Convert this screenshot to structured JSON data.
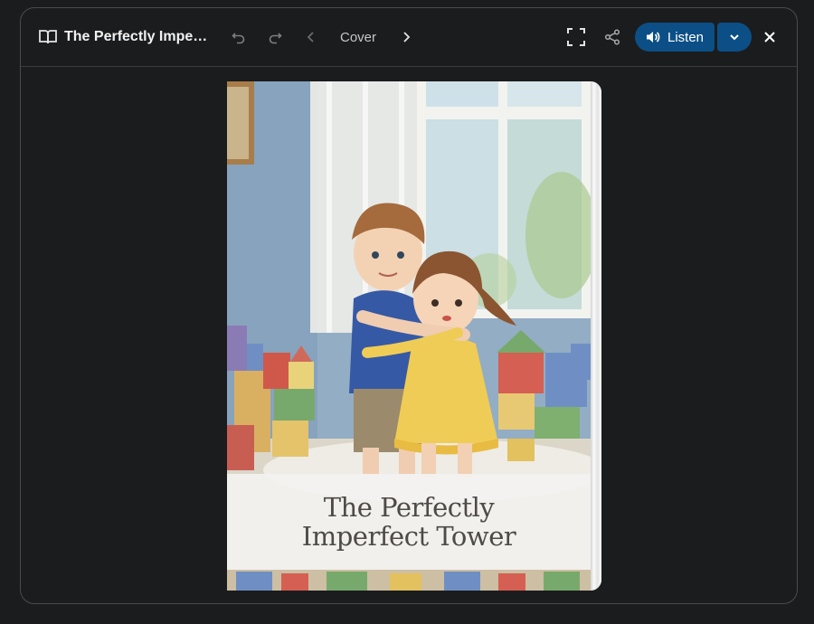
{
  "toolbar": {
    "book_icon": "book-open-icon",
    "title": "The Perfectly Imperfe...",
    "undo_icon": "undo-icon",
    "redo_icon": "redo-icon",
    "prev_icon": "chevron-left-icon",
    "page_label": "Cover",
    "next_icon": "chevron-right-icon",
    "fullscreen_icon": "fullscreen-icon",
    "share_icon": "share-icon",
    "listen_label": "Listen",
    "listen_icon": "speaker-icon",
    "listen_dropdown_icon": "chevron-down-icon",
    "close_icon": "close-icon"
  },
  "cover": {
    "title": "The Perfectly Imperfect Tower"
  },
  "colors": {
    "background": "#1b1c1e",
    "accent": "#0b4f86",
    "border": "#4a4b4e"
  }
}
